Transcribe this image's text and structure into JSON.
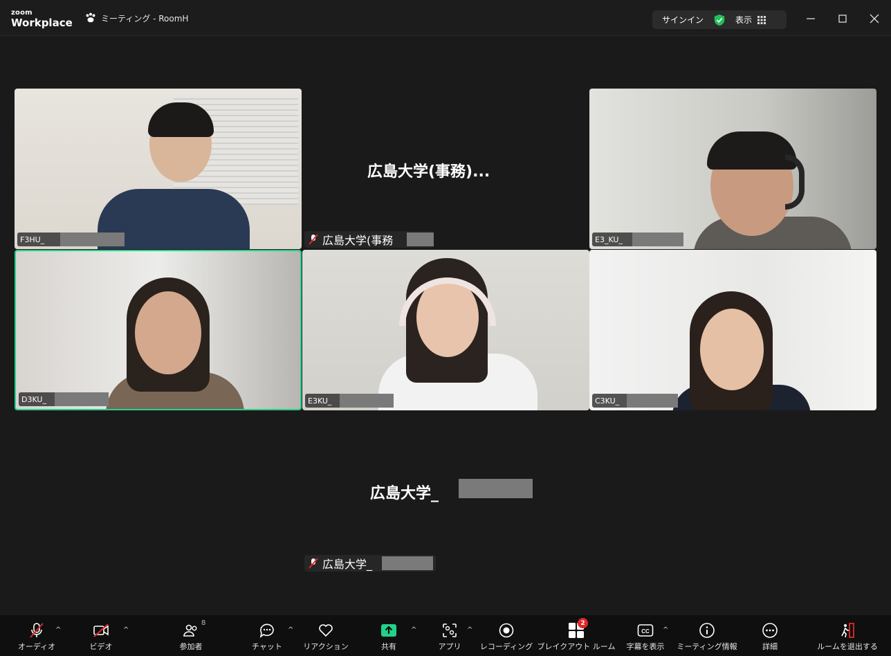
{
  "app": {
    "logo_line1": "zoom",
    "logo_line2": "Workplace",
    "meeting_title": "ミーティング - RoomH",
    "signin": "サインイン",
    "view": "表示"
  },
  "tiles": {
    "t1": {
      "name": "F3HU_"
    },
    "t2": {
      "display_name": "広島大学(事務)...",
      "plate": "広島大学(事務"
    },
    "t3": {
      "name": "E3_KU_"
    },
    "t4": {
      "name": "D3KU_"
    },
    "t5": {
      "name": "E3KU_"
    },
    "t6": {
      "name": "C3KU_"
    },
    "t7": {
      "display_name": "広島大学_",
      "plate": "広島大学_"
    }
  },
  "toolbar": {
    "audio": "オーディオ",
    "video": "ビデオ",
    "participants": "参加者",
    "participants_count": "8",
    "chat": "チャット",
    "reactions": "リアクション",
    "share": "共有",
    "apps": "アプリ",
    "recording": "レコーディング",
    "breakout": "ブレイクアウト ルーム",
    "breakout_badge": "2",
    "captions": "字幕を表示",
    "meeting_info": "ミーティング情報",
    "more": "詳細",
    "leave": "ルームを退出する"
  },
  "colors": {
    "active_speaker": "#23d18b",
    "share_green": "#23d18b",
    "mute_red": "#e02828",
    "shield_green": "#21c15a"
  }
}
